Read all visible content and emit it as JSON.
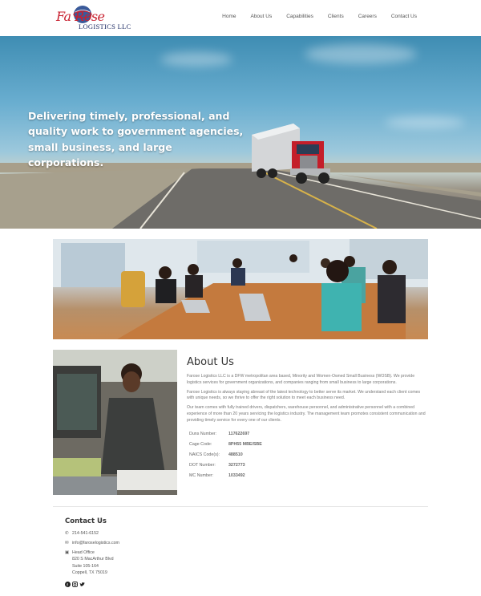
{
  "logo": {
    "script_text": "Fa Rose",
    "sub_text": "LOGISTICS LLC"
  },
  "nav": {
    "items": [
      {
        "label": "Home"
      },
      {
        "label": "About Us"
      },
      {
        "label": "Capabilities"
      },
      {
        "label": "Clients"
      },
      {
        "label": "Careers"
      },
      {
        "label": "Contact Us"
      }
    ]
  },
  "hero": {
    "headline": "Delivering timely, professional, and quality work to government agencies, small business, and large corporations."
  },
  "about": {
    "title": "About Us",
    "paragraphs": [
      "Farose Logistics LLC is a DFW metropolitan area based, Minority and Women-Owned Small Business (WOSB). We provide logistics services for government organizations, and companies ranging from small business to large corporations.",
      "Farose Logistics is always staying abreast of the latest technology to better serve its market. We understand each client comes with unique needs, so we thrive to offer the right solution to meet each business need.",
      "Our team comes with fully trained drivers, dispatchers, warehouse personnel, and administrative personnel with a combined experience of more than 20 years servicing the logistics industry. The management team promotes consistent communication and providing timely service for every one of our clients."
    ],
    "info": [
      {
        "label": "Duns Number:",
        "value": "117622697"
      },
      {
        "label": "Cage Code:",
        "value": "8PH55 MBE/SBE"
      },
      {
        "label": "NAICS Code(s):",
        "value": "488510"
      },
      {
        "label": "DOT Number:",
        "value": "3272773"
      },
      {
        "label": "MC Number:",
        "value": "1033492"
      }
    ]
  },
  "contact": {
    "title": "Contact Us",
    "phone": "214-541-6152",
    "email": "info@faroselogistics.com",
    "office_label": "Head Office",
    "address_line1": "820 S MacArthur Blvd",
    "address_line2": "Suite 105-164",
    "address_line3": "Coppell, TX 75019"
  },
  "social": [
    "facebook-icon",
    "instagram-icon",
    "twitter-icon"
  ],
  "colors": {
    "brand_red": "#c8202f",
    "brand_navy": "#1d2b63",
    "truck_red": "#c41e2a"
  }
}
